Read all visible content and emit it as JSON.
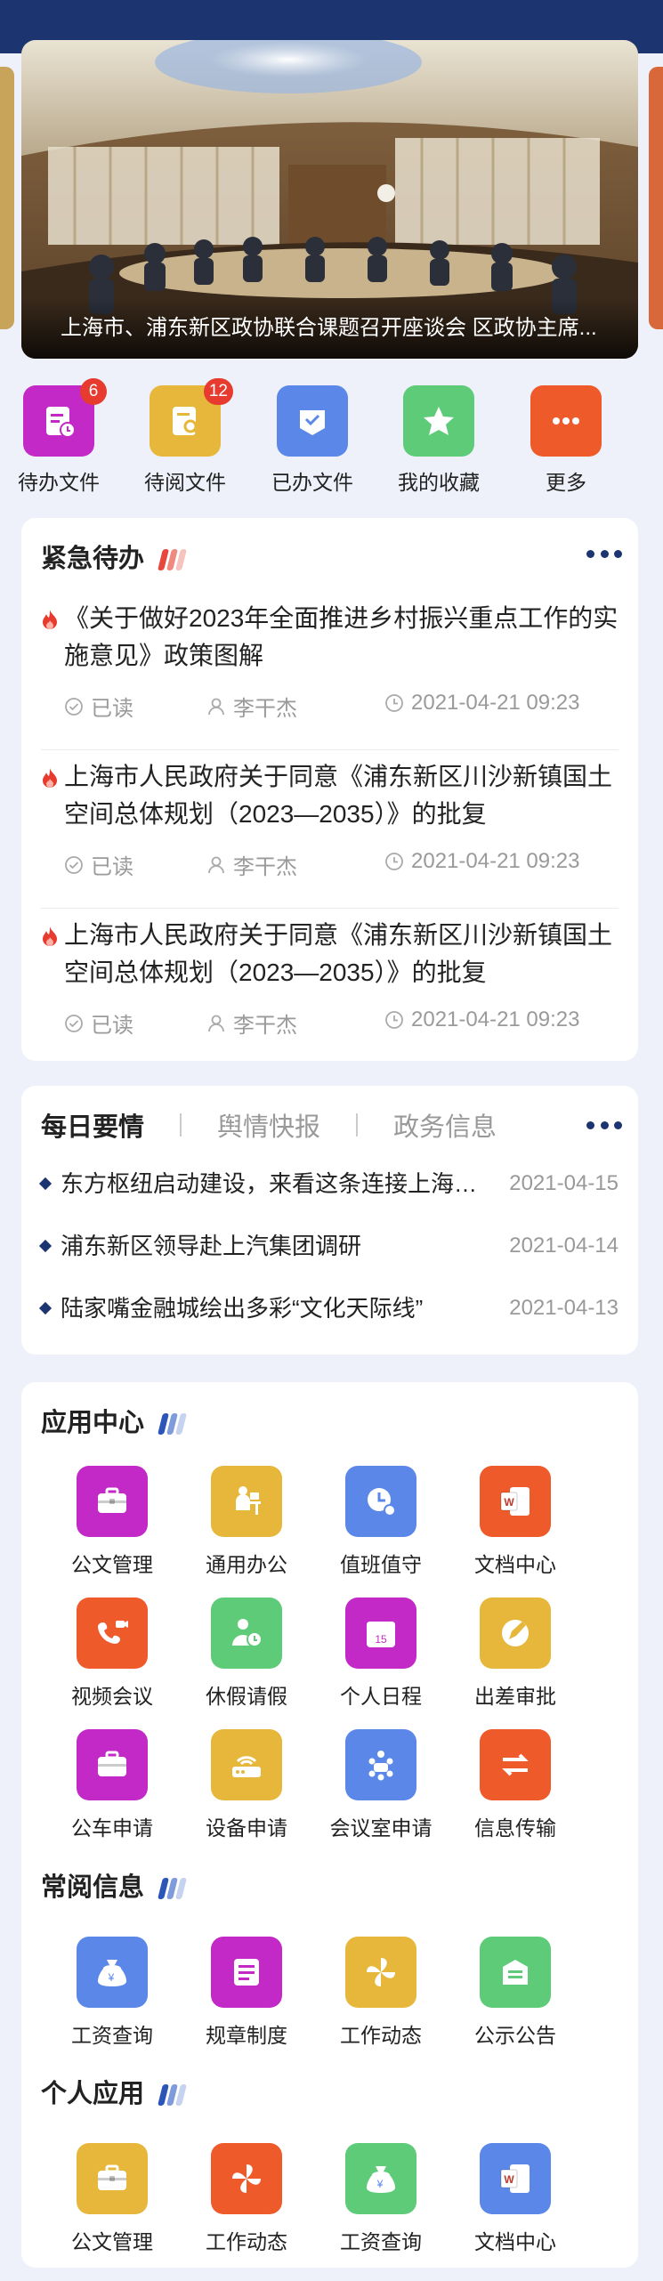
{
  "banner": {
    "caption": "上海市、浦东新区政协联合课题召开座谈会 区政协主席..."
  },
  "quick_actions": [
    {
      "label": "待办文件",
      "badge": "6",
      "icon": "pending-doc-icon",
      "color": "#c229c6"
    },
    {
      "label": "待阅文件",
      "badge": "12",
      "icon": "read-doc-icon",
      "color": "#e6b73a"
    },
    {
      "label": "已办文件",
      "badge": "",
      "icon": "done-doc-icon",
      "color": "#5b88e8"
    },
    {
      "label": "我的收藏",
      "badge": "",
      "icon": "star-icon",
      "color": "#5ecb79"
    },
    {
      "label": "更多",
      "badge": "",
      "icon": "more-icon",
      "color": "#ef5a2a"
    }
  ],
  "urgent": {
    "title": "紧急待办",
    "items": [
      {
        "title": "《关于做好2023年全面推进乡村振兴重点工作的实施意见》政策图解",
        "status": "已读",
        "person": "李干杰",
        "time": "2021-04-21 09:23"
      },
      {
        "title": "上海市人民政府关于同意《浦东新区川沙新镇国土空间总体规划（2023—2035）》的批复",
        "status": "已读",
        "person": "李干杰",
        "time": "2021-04-21 09:23"
      },
      {
        "title": "上海市人民政府关于同意《浦东新区川沙新镇国土空间总体规划（2023—2035）》的批复",
        "status": "已读",
        "person": "李干杰",
        "time": "2021-04-21 09:23"
      }
    ]
  },
  "news": {
    "tabs": [
      "每日要情",
      "舆情快报",
      "政务信息"
    ],
    "items": [
      {
        "title": "东方枢纽启动建设，来看这条连接上海东西的交通大动脉",
        "date": "2021-04-15"
      },
      {
        "title": "浦东新区领导赴上汽集团调研",
        "date": "2021-04-14"
      },
      {
        "title": "陆家嘴金融城绘出多彩“文化天际线”",
        "date": "2021-04-13"
      }
    ]
  },
  "app_center": {
    "title": "应用中心",
    "apps": [
      {
        "label": "公文管理",
        "icon": "briefcase-icon",
        "color": "#c229c6"
      },
      {
        "label": "通用办公",
        "icon": "office-desk-icon",
        "color": "#e6b73a"
      },
      {
        "label": "值班值守",
        "icon": "clock-duty-icon",
        "color": "#5b88e8"
      },
      {
        "label": "文档中心",
        "icon": "word-doc-icon",
        "color": "#ef5a2a"
      },
      {
        "label": "视频会议",
        "icon": "video-call-icon",
        "color": "#ef5a2a"
      },
      {
        "label": "休假请假",
        "icon": "leave-person-icon",
        "color": "#5ecb79"
      },
      {
        "label": "个人日程",
        "icon": "calendar-icon",
        "color": "#c229c6"
      },
      {
        "label": "出差审批",
        "icon": "approve-pen-icon",
        "color": "#e6b73a"
      },
      {
        "label": "公车申请",
        "icon": "car-case-icon",
        "color": "#c229c6"
      },
      {
        "label": "设备申请",
        "icon": "router-icon",
        "color": "#e6b73a"
      },
      {
        "label": "会议室申请",
        "icon": "meeting-room-icon",
        "color": "#5b88e8"
      },
      {
        "label": "信息传输",
        "icon": "transfer-icon",
        "color": "#ef5a2a"
      }
    ]
  },
  "frequent": {
    "title": "常阅信息",
    "apps": [
      {
        "label": "工资查询",
        "icon": "salary-bag-icon",
        "color": "#5b88e8"
      },
      {
        "label": "规章制度",
        "icon": "rules-doc-icon",
        "color": "#c229c6"
      },
      {
        "label": "工作动态",
        "icon": "pinwheel-icon",
        "color": "#e6b73a"
      },
      {
        "label": "公示公告",
        "icon": "notice-box-icon",
        "color": "#5ecb79"
      }
    ]
  },
  "personal": {
    "title": "个人应用",
    "apps": [
      {
        "label": "公文管理",
        "icon": "briefcase-icon",
        "color": "#e6b73a"
      },
      {
        "label": "工作动态",
        "icon": "pinwheel-icon",
        "color": "#ef5a2a"
      },
      {
        "label": "工资查询",
        "icon": "salary-bag-icon",
        "color": "#5ecb79"
      },
      {
        "label": "文档中心",
        "icon": "word-doc-icon",
        "color": "#5b88e8"
      }
    ]
  }
}
